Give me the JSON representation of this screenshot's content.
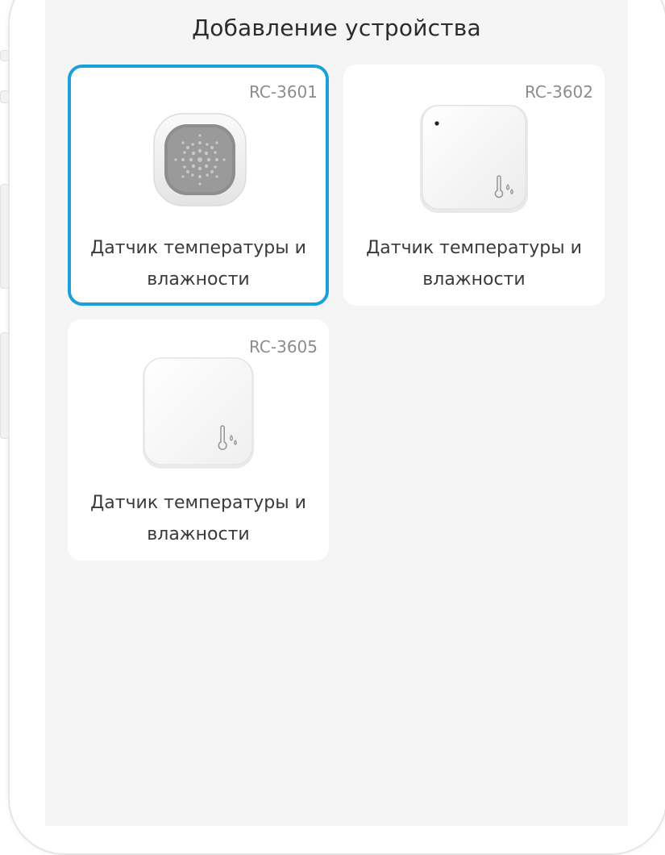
{
  "page": {
    "title": "Добавление устройства"
  },
  "devices": [
    {
      "model": "RC-3601",
      "name_line1": "Датчик температуры и",
      "name_line2": "влажности",
      "selected": true,
      "image_icon": "round-sensor-speaker-icon"
    },
    {
      "model": "RC-3602",
      "name_line1": "Датчик температуры и",
      "name_line2": "влажности",
      "selected": false,
      "image_icon": "square-sensor-thermometer-icon"
    },
    {
      "model": "RC-3605",
      "name_line1": "Датчик температуры и",
      "name_line2": "влажности",
      "selected": false,
      "image_icon": "square-sensor-thermometer-icon"
    }
  ],
  "colors": {
    "selection_border": "#1aa0dc",
    "screen_background": "#f5f5f5",
    "card_background": "#ffffff",
    "title_text": "#2b2b2b",
    "model_text": "#8c8c8c"
  }
}
